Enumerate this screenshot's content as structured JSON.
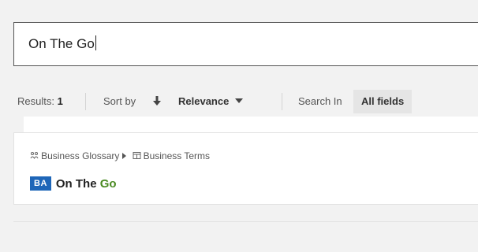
{
  "search": {
    "value": "On The Go"
  },
  "results_bar": {
    "results_label": "Results:",
    "results_count": "1",
    "sort_label": "Sort by",
    "sort_direction_icon": "arrow-down-icon",
    "sort_value": "Relevance",
    "search_in_label": "Search In",
    "search_in_value": "All fields"
  },
  "result": {
    "breadcrumb": {
      "community_icon": "community-icon",
      "community": "Business Glossary",
      "domain_icon": "glossary-icon",
      "domain": "Business Terms"
    },
    "badge": "BA",
    "title_prefix": "On The ",
    "title_highlight": "Go"
  },
  "colors": {
    "badge_bg": "#1e66b8",
    "highlight": "#4a8a22"
  }
}
